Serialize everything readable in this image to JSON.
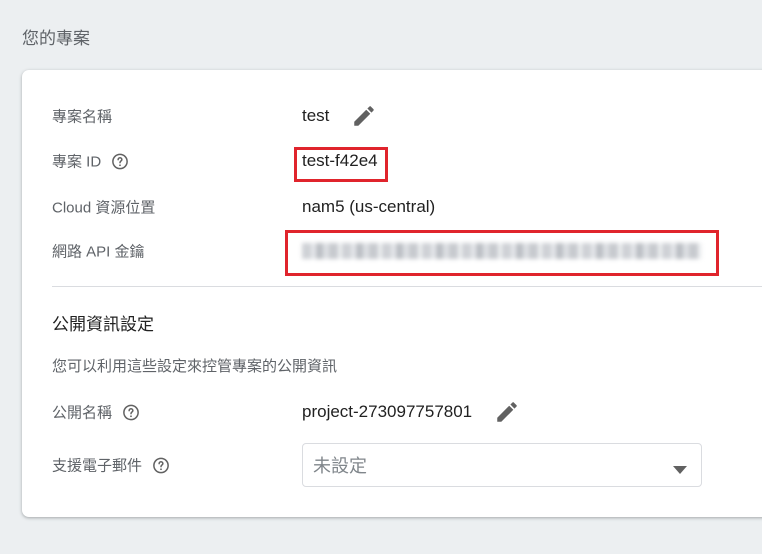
{
  "page": {
    "heading": "您的專案"
  },
  "project": {
    "name_label": "專案名稱",
    "name_value": "test",
    "id_label": "專案 ID",
    "id_value": "test-f42e4",
    "location_label": "Cloud 資源位置",
    "location_value": "nam5 (us-central)",
    "api_key_label": "網路 API 金鑰"
  },
  "public_settings": {
    "title": "公開資訊設定",
    "description": "您可以利用這些設定來控管專案的公開資訊",
    "public_name_label": "公開名稱",
    "public_name_value": "project-273097757801",
    "support_email_label": "支援電子郵件",
    "support_email_value": "未設定"
  },
  "colors": {
    "highlight": "#e0242c",
    "label_text": "#5f6368",
    "value_text": "#212121",
    "icon": "#616161"
  },
  "icons": {
    "edit": "edit-pencil-icon",
    "help": "help-circle-icon",
    "dropdown": "dropdown-arrow-icon"
  }
}
